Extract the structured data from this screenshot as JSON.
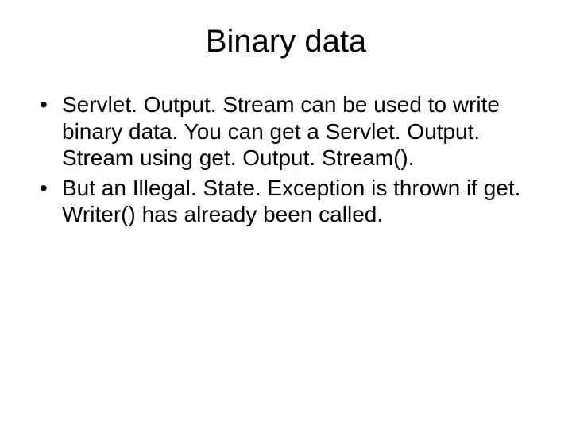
{
  "slide": {
    "title": "Binary data",
    "bullets": [
      "Servlet. Output. Stream can be used to write binary data.  You can get a Servlet. Output. Stream using get. Output. Stream().",
      "But an Illegal. State. Exception is thrown if get. Writer() has already been called."
    ]
  }
}
